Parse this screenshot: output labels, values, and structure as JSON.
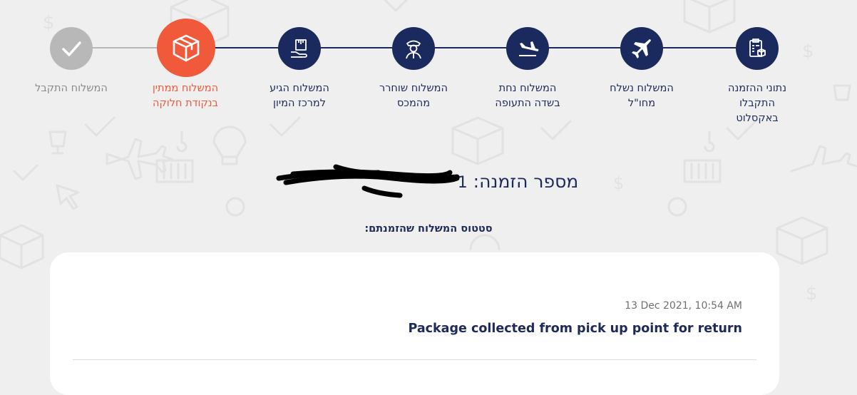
{
  "tracker": {
    "steps": [
      {
        "lines": [
          "נתוני ההזמנה",
          "התקבלו",
          "באקסלוט"
        ],
        "state": "done",
        "icon": "clipboard-package-icon"
      },
      {
        "lines": [
          "המשלוח נשלח",
          "מחו\"ל"
        ],
        "state": "done",
        "icon": "airplane-icon"
      },
      {
        "lines": [
          "המשלוח נחת",
          "בשדה התעופה"
        ],
        "state": "done",
        "icon": "airplane-landing-icon"
      },
      {
        "lines": [
          "המשלוח שוחרר",
          "מהמכס"
        ],
        "state": "done",
        "icon": "customs-officer-icon"
      },
      {
        "lines": [
          "המשלוח הגיע",
          "למרכז המיון"
        ],
        "state": "done",
        "icon": "package-hand-icon"
      },
      {
        "lines": [
          "המשלוח ממתין",
          "בנקודת חלוקה"
        ],
        "state": "current",
        "icon": "open-box-icon"
      },
      {
        "lines": [
          "המשלוח התקבל"
        ],
        "state": "pending",
        "icon": "checkmark-icon"
      }
    ],
    "colors": {
      "done": "#1b2a5e",
      "current": "#f05a3a",
      "pending": "#b8b8b8"
    }
  },
  "order": {
    "label": "מספר הזמנה:",
    "number_prefix": "1"
  },
  "status": {
    "heading": "סטטוס המשלוח שהזמנתם:"
  },
  "events": [
    {
      "timestamp": "13 Dec 2021, 10:54 AM",
      "description": "Package collected from pick up point for return"
    }
  ]
}
